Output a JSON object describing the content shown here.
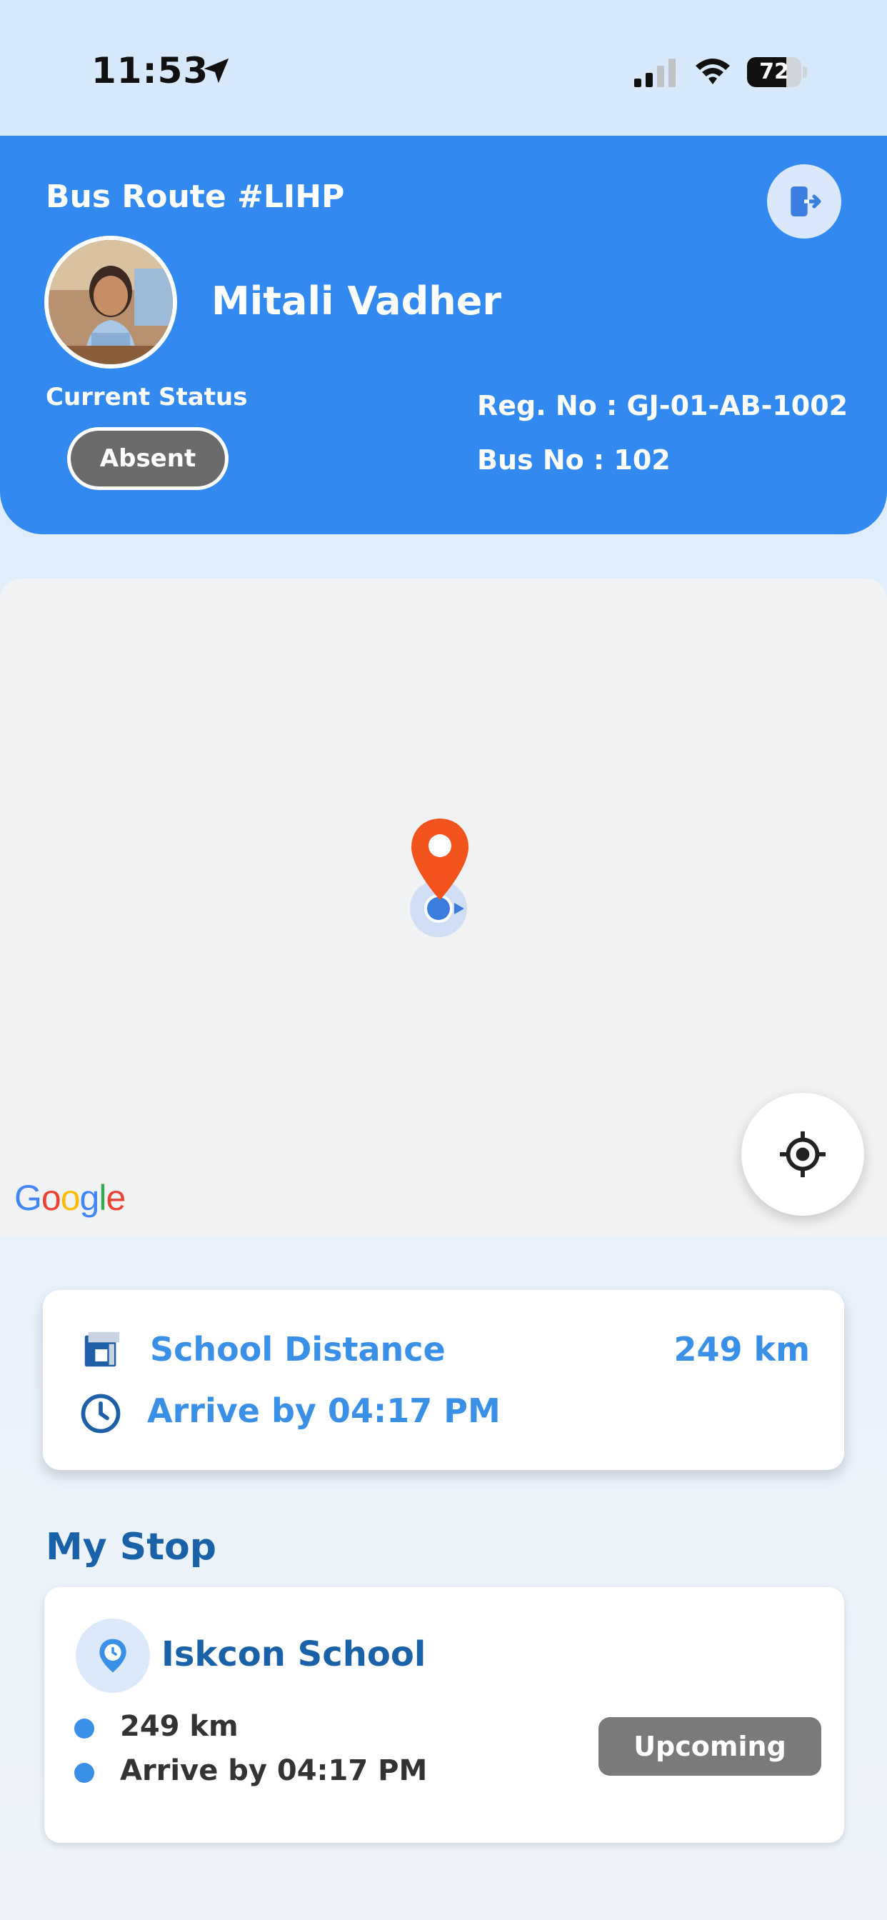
{
  "status_bar": {
    "time": "11:53",
    "battery": "72",
    "battery_level": 0.72,
    "icons": [
      "location-arrow-icon",
      "cellular-signal-icon",
      "wifi-icon",
      "battery-icon"
    ]
  },
  "header": {
    "route_title": "Bus Route #LIHP",
    "student_name": "Mitali Vadher",
    "current_status_label": "Current Status",
    "status": "Absent",
    "reg_no": "Reg. No : GJ-01-AB-1002",
    "bus_no": "Bus No : 102",
    "logout_icon": "logout-icon",
    "colors": {
      "accent": "#3289f0",
      "status_pill": "#6b6b6b"
    }
  },
  "map": {
    "attribution": "Google",
    "pin_icon": "map-pin-icon",
    "recenter_icon": "gps-crosshair-icon",
    "pin_color": "#f2531c"
  },
  "trip": {
    "school_distance_label": "School Distance",
    "school_distance_value": "249 km",
    "arrive_by": "Arrive by 04:17 PM",
    "text_color": "#3a8fe6"
  },
  "my_stop": {
    "title": "My Stop",
    "stop_name": "Iskcon School",
    "distance": "249 km",
    "arrive_by": "Arrive by 04:17 PM",
    "badge": "Upcoming"
  }
}
